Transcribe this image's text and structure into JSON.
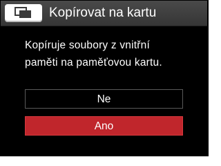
{
  "title_bar": {
    "icon": "copy-to-card-icon",
    "title": "Kopírovat na kartu"
  },
  "message": {
    "line1": "Kopíruje soubory z vnitřní",
    "line2": "paměti na paměťovou kartu."
  },
  "options": {
    "no_label": "Ne",
    "yes_label": "Ano",
    "selected": "Ano"
  },
  "colors": {
    "background": "#000000",
    "title_bar": "#3d3d3d",
    "selected_button": "#c0262c",
    "text": "#ffffff"
  }
}
